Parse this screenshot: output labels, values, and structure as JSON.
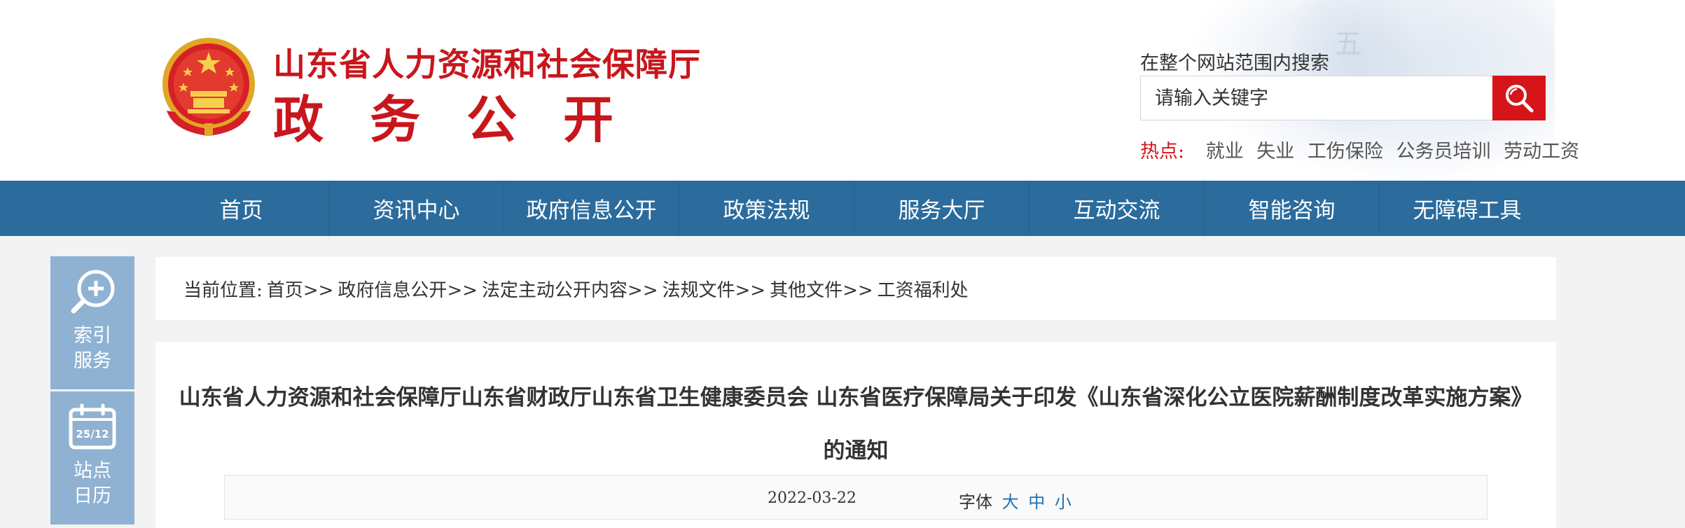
{
  "header": {
    "title": "山东省人力资源和社会保障厅",
    "subtitle": "政务公开"
  },
  "search": {
    "label": "在整个网站范围内搜索",
    "placeholder": "请输入关键字"
  },
  "hot": {
    "label": "热点:",
    "items": [
      "就业",
      "失业",
      "工伤保险",
      "公务员培训",
      "劳动工资"
    ]
  },
  "nav": [
    "首页",
    "资讯中心",
    "政府信息公开",
    "政策法规",
    "服务大厅",
    "互动交流",
    "智能咨询",
    "无障碍工具"
  ],
  "side": [
    {
      "label": "索引服务",
      "icon": "search-plus-icon"
    },
    {
      "label": "站点日历",
      "icon": "calendar-icon",
      "calendar_text": "25/12"
    }
  ],
  "breadcrumb": {
    "prefix": "当前位置:",
    "items": [
      "首页>>",
      "政府信息公开>>",
      "法定主动公开内容>>",
      "法规文件>>",
      "其他文件>>",
      "工资福利处"
    ]
  },
  "article": {
    "title": "山东省人力资源和社会保障厅山东省财政厅山东省卫生健康委员会 山东省医疗保障局关于印发《山东省深化公立医院薪酬制度改革实施方案》的通知",
    "date": "2022-03-22",
    "font_label": "字体",
    "font_sizes": [
      "大",
      "中",
      "小"
    ]
  },
  "colors": {
    "brand_red": "#c8161d",
    "nav_blue": "#2b6c9d",
    "side_blue": "#8fb2d3",
    "link_blue": "#1f6fb5"
  }
}
